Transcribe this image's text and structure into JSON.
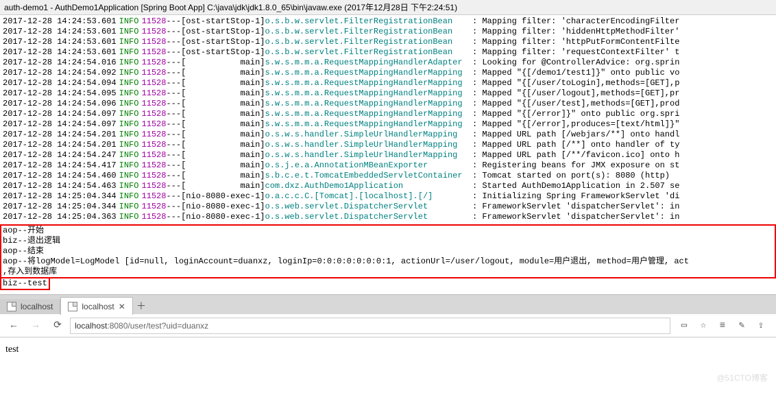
{
  "titlebar": "auth-demo1 - AuthDemo1Application [Spring Boot App] C:\\java\\jdk\\jdk1.8.0_65\\bin\\javaw.exe (2017年12月28日 下午2:24:51)",
  "logs": [
    {
      "ts": "2017-12-28 14:24:53.601",
      "level": "INFO",
      "pid": "11528",
      "thread": "[ost-startStop-1]",
      "logger": "o.s.b.w.servlet.FilterRegistrationBean    ",
      "msg": ": Mapping filter: 'characterEncodingFilter"
    },
    {
      "ts": "2017-12-28 14:24:53.601",
      "level": "INFO",
      "pid": "11528",
      "thread": "[ost-startStop-1]",
      "logger": "o.s.b.w.servlet.FilterRegistrationBean    ",
      "msg": ": Mapping filter: 'hiddenHttpMethodFilter'"
    },
    {
      "ts": "2017-12-28 14:24:53.601",
      "level": "INFO",
      "pid": "11528",
      "thread": "[ost-startStop-1]",
      "logger": "o.s.b.w.servlet.FilterRegistrationBean    ",
      "msg": ": Mapping filter: 'httpPutFormContentFilte"
    },
    {
      "ts": "2017-12-28 14:24:53.601",
      "level": "INFO",
      "pid": "11528",
      "thread": "[ost-startStop-1]",
      "logger": "o.s.b.w.servlet.FilterRegistrationBean    ",
      "msg": ": Mapping filter: 'requestContextFilter' t"
    },
    {
      "ts": "2017-12-28 14:24:54.016",
      "level": "INFO",
      "pid": "11528",
      "thread": "[           main]",
      "logger": "s.w.s.m.m.a.RequestMappingHandlerAdapter  ",
      "msg": ": Looking for @ControllerAdvice: org.sprin"
    },
    {
      "ts": "2017-12-28 14:24:54.092",
      "level": "INFO",
      "pid": "11528",
      "thread": "[           main]",
      "logger": "s.w.s.m.m.a.RequestMappingHandlerMapping  ",
      "msg": ": Mapped \"{[/demo1/test1]}\" onto public vo"
    },
    {
      "ts": "2017-12-28 14:24:54.094",
      "level": "INFO",
      "pid": "11528",
      "thread": "[           main]",
      "logger": "s.w.s.m.m.a.RequestMappingHandlerMapping  ",
      "msg": ": Mapped \"{[/user/toLogin],methods=[GET],p"
    },
    {
      "ts": "2017-12-28 14:24:54.095",
      "level": "INFO",
      "pid": "11528",
      "thread": "[           main]",
      "logger": "s.w.s.m.m.a.RequestMappingHandlerMapping  ",
      "msg": ": Mapped \"{[/user/logout],methods=[GET],pr"
    },
    {
      "ts": "2017-12-28 14:24:54.096",
      "level": "INFO",
      "pid": "11528",
      "thread": "[           main]",
      "logger": "s.w.s.m.m.a.RequestMappingHandlerMapping  ",
      "msg": ": Mapped \"{[/user/test],methods=[GET],prod"
    },
    {
      "ts": "2017-12-28 14:24:54.097",
      "level": "INFO",
      "pid": "11528",
      "thread": "[           main]",
      "logger": "s.w.s.m.m.a.RequestMappingHandlerMapping  ",
      "msg": ": Mapped \"{[/error]}\" onto public org.spri"
    },
    {
      "ts": "2017-12-28 14:24:54.097",
      "level": "INFO",
      "pid": "11528",
      "thread": "[           main]",
      "logger": "s.w.s.m.m.a.RequestMappingHandlerMapping  ",
      "msg": ": Mapped \"{[/error],produces=[text/html]}\""
    },
    {
      "ts": "2017-12-28 14:24:54.201",
      "level": "INFO",
      "pid": "11528",
      "thread": "[           main]",
      "logger": "o.s.w.s.handler.SimpleUrlHandlerMapping   ",
      "msg": ": Mapped URL path [/webjars/**] onto handl"
    },
    {
      "ts": "2017-12-28 14:24:54.201",
      "level": "INFO",
      "pid": "11528",
      "thread": "[           main]",
      "logger": "o.s.w.s.handler.SimpleUrlHandlerMapping   ",
      "msg": ": Mapped URL path [/**] onto handler of ty"
    },
    {
      "ts": "2017-12-28 14:24:54.247",
      "level": "INFO",
      "pid": "11528",
      "thread": "[           main]",
      "logger": "o.s.w.s.handler.SimpleUrlHandlerMapping   ",
      "msg": ": Mapped URL path [/**/favicon.ico] onto h"
    },
    {
      "ts": "2017-12-28 14:24:54.417",
      "level": "INFO",
      "pid": "11528",
      "thread": "[           main]",
      "logger": "o.s.j.e.a.AnnotationMBeanExporter         ",
      "msg": ": Registering beans for JMX exposure on st"
    },
    {
      "ts": "2017-12-28 14:24:54.460",
      "level": "INFO",
      "pid": "11528",
      "thread": "[           main]",
      "logger": "s.b.c.e.t.TomcatEmbeddedServletContainer  ",
      "msg": ": Tomcat started on port(s): 8080 (http)"
    },
    {
      "ts": "2017-12-28 14:24:54.463",
      "level": "INFO",
      "pid": "11528",
      "thread": "[           main]",
      "logger": "com.dxz.AuthDemo1Application              ",
      "msg": ": Started AuthDemo1Application in 2.507 se"
    },
    {
      "ts": "2017-12-28 14:25:04.344",
      "level": "INFO",
      "pid": "11528",
      "thread": "[nio-8080-exec-1]",
      "logger": "o.a.c.c.C.[Tomcat].[localhost].[/]        ",
      "msg": ": Initializing Spring FrameworkServlet 'di"
    },
    {
      "ts": "2017-12-28 14:25:04.344",
      "level": "INFO",
      "pid": "11528",
      "thread": "[nio-8080-exec-1]",
      "logger": "o.s.web.servlet.DispatcherServlet         ",
      "msg": ": FrameworkServlet 'dispatcherServlet': in"
    },
    {
      "ts": "2017-12-28 14:25:04.363",
      "level": "INFO",
      "pid": "11528",
      "thread": "[nio-8080-exec-1]",
      "logger": "o.s.web.servlet.DispatcherServlet         ",
      "msg": ": FrameworkServlet 'dispatcherServlet': in"
    }
  ],
  "redbox1": [
    "aop--开始",
    "biz--退出逻辑",
    "aop--结束",
    "aop--将logModel=LogModel [id=null, loginAccount=duanxz, loginIp=0:0:0:0:0:0:0:1, actionUrl=/user/logout, module=用户退出, method=用户管理, act",
    ",存入到数据库"
  ],
  "redbox2": "biz--test",
  "browser": {
    "tab_inactive": "localhost",
    "tab_active": "localhost",
    "url_prefix": "localhost",
    "url_suffix": ":8080/user/test?uid=duanxz",
    "page_text": "test"
  },
  "watermark": "@51CTO博客"
}
